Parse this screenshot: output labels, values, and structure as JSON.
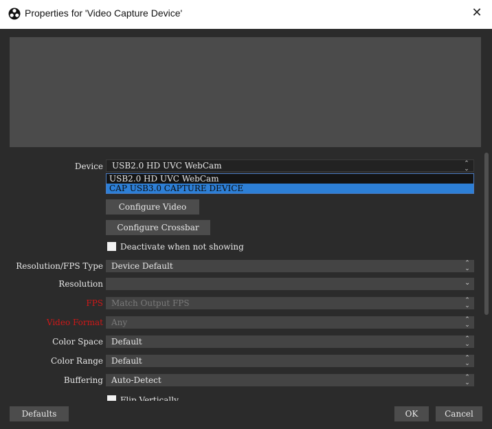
{
  "window": {
    "title": "Properties for 'Video Capture Device'",
    "close_glyph": "✕"
  },
  "device": {
    "label": "Device",
    "value": "USB2.0 HD UVC WebCam",
    "options": [
      "USB2.0 HD UVC WebCam",
      "CAP USB3.0 CAPTURE DEVICE"
    ],
    "highlighted_option": "CAP USB3.0 CAPTURE DEVICE"
  },
  "buttons": {
    "configure_video": "Configure Video",
    "configure_crossbar": "Configure Crossbar"
  },
  "deactivate": {
    "label": "Deactivate when not showing",
    "checked": false
  },
  "settings": [
    {
      "label": "Resolution/FPS Type",
      "value": "Device Default",
      "disabled": false,
      "label_color": "normal"
    },
    {
      "label": "Resolution",
      "value": "",
      "disabled": false,
      "label_color": "normal"
    },
    {
      "label": "FPS",
      "value": "Match Output FPS",
      "disabled": true,
      "label_color": "red"
    },
    {
      "label": "Video Format",
      "value": "Any",
      "disabled": true,
      "label_color": "red"
    },
    {
      "label": "Color Space",
      "value": "Default",
      "disabled": false,
      "label_color": "normal"
    },
    {
      "label": "Color Range",
      "value": "Default",
      "disabled": false,
      "label_color": "normal"
    },
    {
      "label": "Buffering",
      "value": "Auto-Detect",
      "disabled": false,
      "label_color": "normal"
    }
  ],
  "flip": {
    "label": "Flip Vertically",
    "checked": false
  },
  "footer": {
    "defaults": "Defaults",
    "ok": "OK",
    "cancel": "Cancel"
  },
  "icons": {
    "app": "obs-logo-icon",
    "close": "close-icon",
    "spin": "up-down-arrows-icon",
    "chevron": "chevron-down-icon"
  },
  "colors": {
    "background": "#2b2b2b",
    "field": "#444444",
    "highlight": "#2d7fd6",
    "error_label": "#d01818"
  }
}
